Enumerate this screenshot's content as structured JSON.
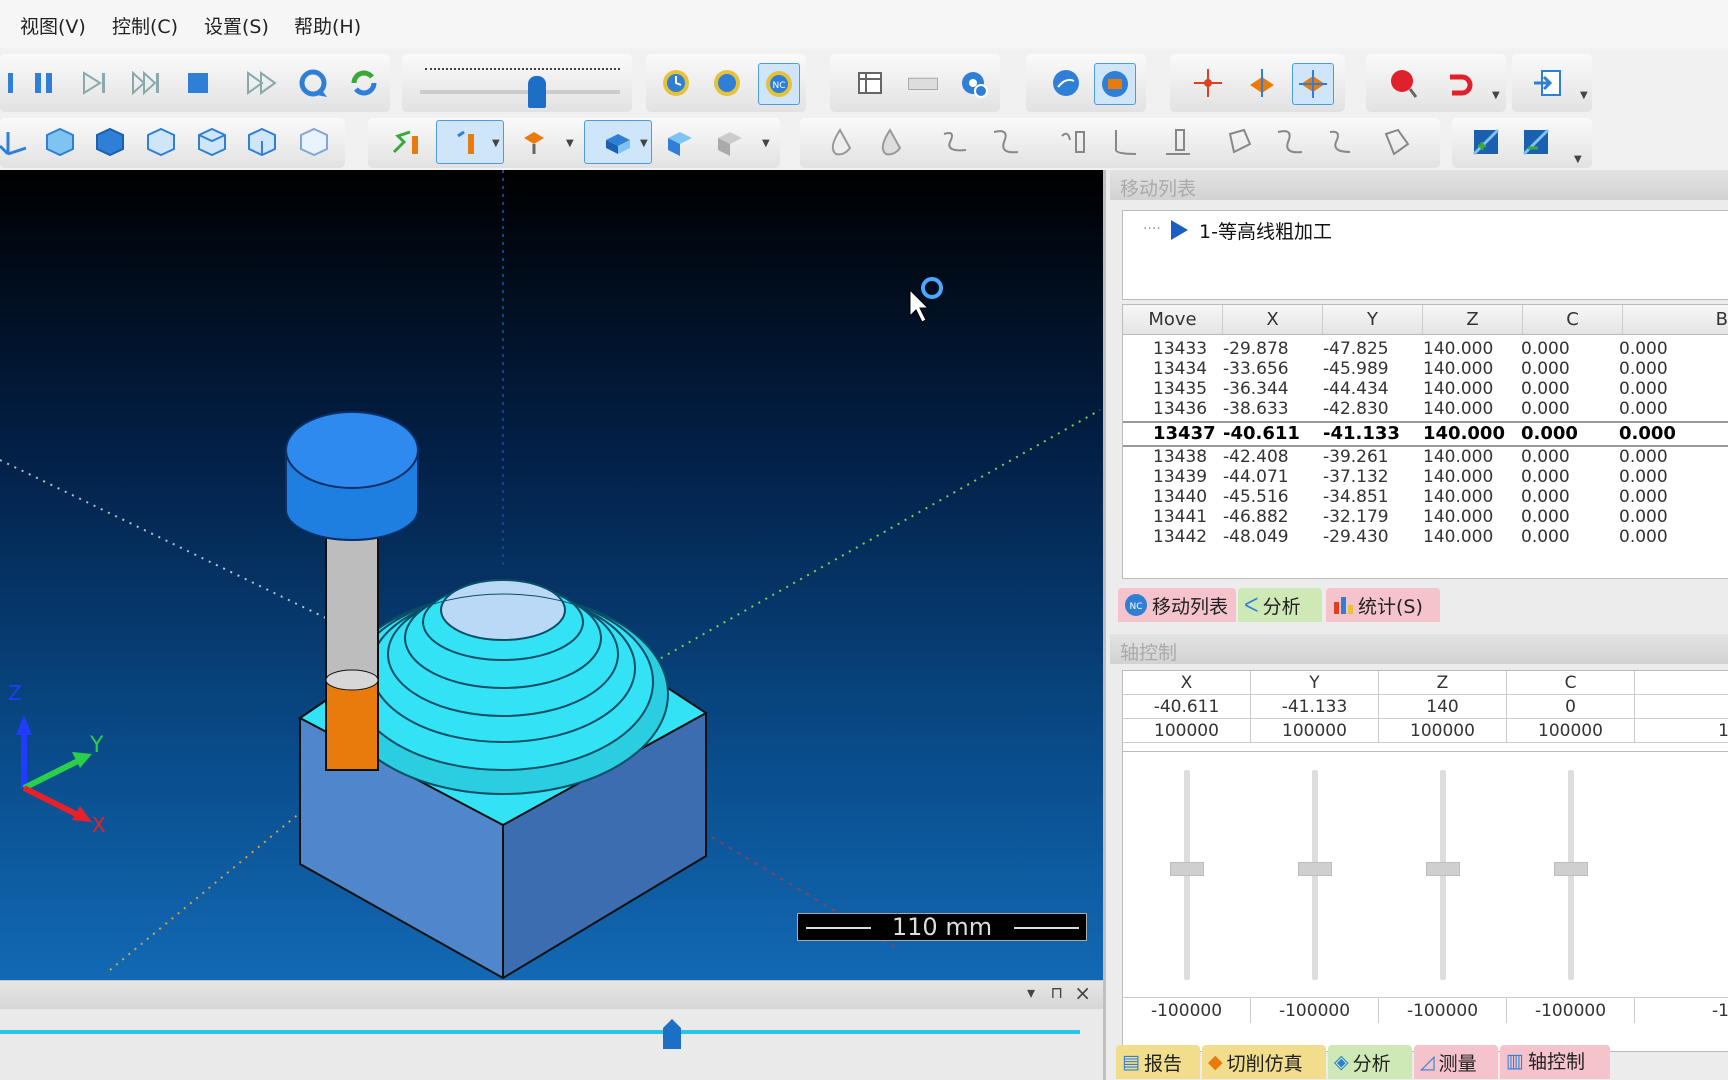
{
  "menu": [
    "视图(V)",
    "控制(C)",
    "设置(S)",
    "帮助(H)"
  ],
  "move_list": {
    "title": "移动列表",
    "tree_item": "1-等高线粗加工",
    "columns": [
      "Move",
      "X",
      "Y",
      "Z",
      "C",
      "B"
    ],
    "rows": [
      [
        "13433",
        "-29.878",
        "-47.825",
        "140.000",
        "0.000",
        "0.000"
      ],
      [
        "13434",
        "-33.656",
        "-45.989",
        "140.000",
        "0.000",
        "0.000"
      ],
      [
        "13435",
        "-36.344",
        "-44.434",
        "140.000",
        "0.000",
        "0.000"
      ],
      [
        "13436",
        "-38.633",
        "-42.830",
        "140.000",
        "0.000",
        "0.000"
      ],
      [
        "13437",
        "-40.611",
        "-41.133",
        "140.000",
        "0.000",
        "0.000"
      ],
      [
        "13438",
        "-42.408",
        "-39.261",
        "140.000",
        "0.000",
        "0.000"
      ],
      [
        "13439",
        "-44.071",
        "-37.132",
        "140.000",
        "0.000",
        "0.000"
      ],
      [
        "13440",
        "-45.516",
        "-34.851",
        "140.000",
        "0.000",
        "0.000"
      ],
      [
        "13441",
        "-46.882",
        "-32.179",
        "140.000",
        "0.000",
        "0.000"
      ],
      [
        "13442",
        "-48.049",
        "-29.430",
        "140.000",
        "0.000",
        "0.000"
      ]
    ],
    "current_row": "13437"
  },
  "panel_tabs": [
    "移动列表",
    "分析",
    "统计(S)"
  ],
  "axis_control": {
    "title": "轴控制",
    "axes": [
      "X",
      "Y",
      "Z",
      "C"
    ],
    "values": [
      "-40.611",
      "-41.133",
      "140",
      "0"
    ],
    "max": [
      "100000",
      "100000",
      "100000",
      "100000",
      "1"
    ],
    "min": [
      "-100000",
      "-100000",
      "-100000",
      "-100000",
      "-1"
    ]
  },
  "bottom_tabs": [
    "报告",
    "切削仿真",
    "分析",
    "测量",
    "轴控制"
  ],
  "viewport": {
    "scale_label": "110 mm",
    "axis_labels": {
      "z": "Z",
      "y": "Y",
      "x": "X"
    }
  },
  "colors": {
    "accent": "#2f7fd6",
    "stock_top": "#33e3f5",
    "tool_holder": "#1e7fe0",
    "tool_cutter": "#e87b0c",
    "tab_pink": "#f4c3cc",
    "tab_yellow": "#f1dd8c",
    "tab_green": "#cfe9b6"
  }
}
